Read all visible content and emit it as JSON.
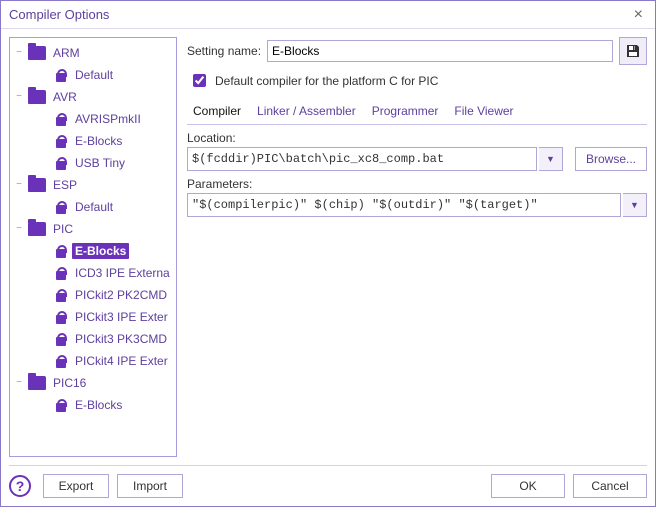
{
  "window": {
    "title": "Compiler Options"
  },
  "tree": {
    "nodes": [
      {
        "type": "folder",
        "depth": 0,
        "label": "ARM",
        "selected": false
      },
      {
        "type": "leaf",
        "depth": 1,
        "label": "Default",
        "selected": false
      },
      {
        "type": "folder",
        "depth": 0,
        "label": "AVR",
        "selected": false
      },
      {
        "type": "leaf",
        "depth": 1,
        "label": "AVRISPmkII",
        "selected": false
      },
      {
        "type": "leaf",
        "depth": 1,
        "label": "E-Blocks",
        "selected": false
      },
      {
        "type": "leaf",
        "depth": 1,
        "label": "USB Tiny",
        "selected": false
      },
      {
        "type": "folder",
        "depth": 0,
        "label": "ESP",
        "selected": false
      },
      {
        "type": "leaf",
        "depth": 1,
        "label": "Default",
        "selected": false
      },
      {
        "type": "folder",
        "depth": 0,
        "label": "PIC",
        "selected": false
      },
      {
        "type": "leaf",
        "depth": 1,
        "label": "E-Blocks",
        "selected": true
      },
      {
        "type": "leaf",
        "depth": 1,
        "label": "ICD3 IPE Externa",
        "selected": false
      },
      {
        "type": "leaf",
        "depth": 1,
        "label": "PICkit2 PK2CMD",
        "selected": false
      },
      {
        "type": "leaf",
        "depth": 1,
        "label": "PICkit3 IPE Exter",
        "selected": false
      },
      {
        "type": "leaf",
        "depth": 1,
        "label": "PICkit3 PK3CMD",
        "selected": false
      },
      {
        "type": "leaf",
        "depth": 1,
        "label": "PICkit4 IPE Exter",
        "selected": false
      },
      {
        "type": "folder",
        "depth": 0,
        "label": "PIC16",
        "selected": false
      },
      {
        "type": "leaf",
        "depth": 1,
        "label": "E-Blocks",
        "selected": false
      }
    ]
  },
  "settings": {
    "name_label": "Setting name:",
    "name_value": "E-Blocks",
    "default_checkbox_label": "Default compiler for the platform C for PIC",
    "default_checked": true
  },
  "tabs": [
    {
      "label": "Compiler",
      "active": true
    },
    {
      "label": "Linker / Assembler",
      "active": false
    },
    {
      "label": "Programmer",
      "active": false
    },
    {
      "label": "File Viewer",
      "active": false
    }
  ],
  "compiler": {
    "location_label": "Location:",
    "location_value": "$(fcddir)PIC\\batch\\pic_xc8_comp.bat",
    "browse_label": "Browse...",
    "parameters_label": "Parameters:",
    "parameters_value": "\"$(compilerpic)\" $(chip) \"$(outdir)\" \"$(target)\""
  },
  "footer": {
    "export_label": "Export",
    "import_label": "Import",
    "ok_label": "OK",
    "cancel_label": "Cancel"
  },
  "accent": "#6a32b8"
}
